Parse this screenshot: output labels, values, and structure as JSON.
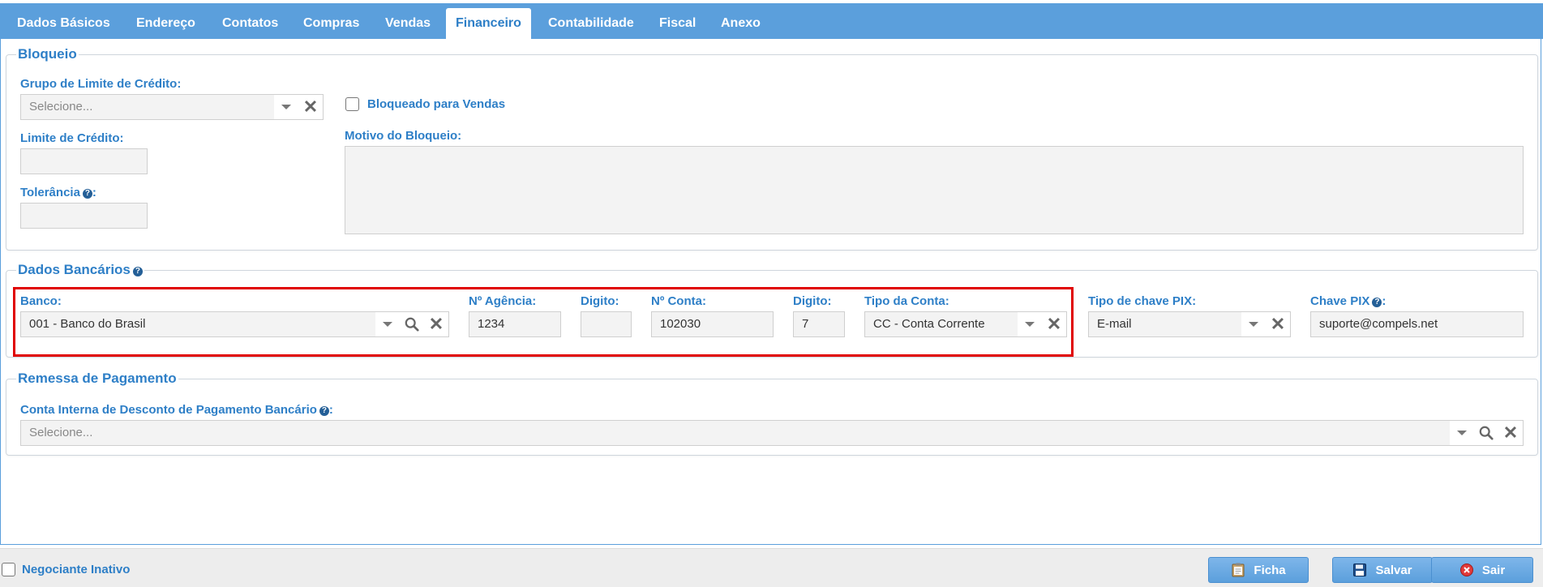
{
  "tabs": [
    {
      "label": "Dados Básicos"
    },
    {
      "label": "Endereço"
    },
    {
      "label": "Contatos"
    },
    {
      "label": "Compras"
    },
    {
      "label": "Vendas"
    },
    {
      "label": "Financeiro",
      "active": true
    },
    {
      "label": "Contabilidade"
    },
    {
      "label": "Fiscal"
    },
    {
      "label": "Anexo"
    }
  ],
  "bloqueio": {
    "legend": "Bloqueio",
    "grupo_label": "Grupo de Limite de Crédito:",
    "grupo_placeholder": "Selecione...",
    "limite_label": "Limite de Crédito:",
    "limite_value": "",
    "tolerancia_label": "Tolerância",
    "tolerancia_suffix": ":",
    "tolerancia_value": "",
    "bloqueado_label": "Bloqueado para Vendas",
    "bloqueado_checked": false,
    "motivo_label": "Motivo do Bloqueio:",
    "motivo_value": ""
  },
  "bancarios": {
    "legend": "Dados Bancários",
    "banco_label": "Banco:",
    "banco_value": "001 - Banco do Brasil",
    "agencia_label": "Nº Agência:",
    "agencia_value": "1234",
    "digito1_label": "Digito:",
    "digito1_value": "",
    "conta_label": "Nº Conta:",
    "conta_value": "102030",
    "digito2_label": "Digito:",
    "digito2_value": "7",
    "tipo_conta_label": "Tipo da Conta:",
    "tipo_conta_value": "CC - Conta Corrente",
    "tipo_pix_label": "Tipo de chave PIX:",
    "tipo_pix_value": "E-mail",
    "chave_pix_label": "Chave PIX",
    "chave_pix_suffix": ":",
    "chave_pix_value": "suporte@compels.net"
  },
  "remessa": {
    "legend": "Remessa de Pagamento",
    "conta_label": "Conta Interna de Desconto de Pagamento Bancário",
    "conta_suffix": ":",
    "conta_placeholder": "Selecione..."
  },
  "footer": {
    "inativo_label": "Negociante Inativo",
    "inativo_checked": false,
    "ficha_label": "Ficha",
    "salvar_label": "Salvar",
    "sair_label": "Sair"
  },
  "colors": {
    "accent": "#5b9fdc",
    "label": "#2e7fc7",
    "highlight": "#e00000"
  }
}
